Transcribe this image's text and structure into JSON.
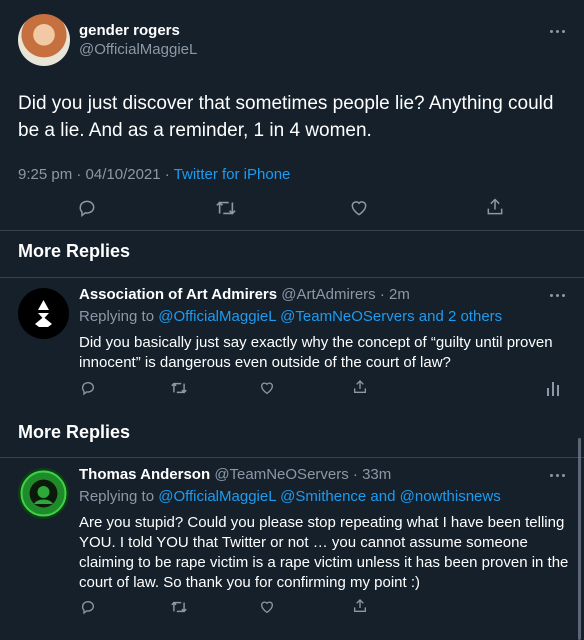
{
  "main_tweet": {
    "display_name": "gender rogers",
    "handle": "@OfficialMaggieL",
    "text": "Did you just discover that sometimes people lie? Anything could be a lie. And as a reminder, 1 in 4 women.",
    "meta_time": "9:25 pm · 04/10/2021 · ",
    "meta_source": "Twitter for iPhone"
  },
  "section1": {
    "title": "More Replies"
  },
  "reply1": {
    "display_name": "Association of Art Admirers",
    "handle_time": "@ArtAdmirers · 2m",
    "replying_label": "Replying to ",
    "replying_to": "@OfficialMaggieL @TeamNeOServers and 2 others",
    "text": "Did you basically just say exactly why the concept of “guilty until proven innocent” is dangerous even outside of the court of law?"
  },
  "section2": {
    "title": "More Replies"
  },
  "reply2": {
    "display_name": "Thomas Anderson",
    "handle_time": "@TeamNeOServers · 33m",
    "replying_label": "Replying to ",
    "replying_to": "@OfficialMaggieL @Smithence and @nowthisnews",
    "text": "Are you stupid? Could you please stop repeating what I have been telling YOU. I told YOU that Twitter or not … you cannot assume someone claiming to be rape victim is a rape victim unless it has been proven in the court of law. So thank you for confirming my point :)"
  },
  "colors": {
    "background": "#15202b",
    "accent": "#1d9bf0",
    "muted": "#8b98a5",
    "divider": "#38444d"
  }
}
